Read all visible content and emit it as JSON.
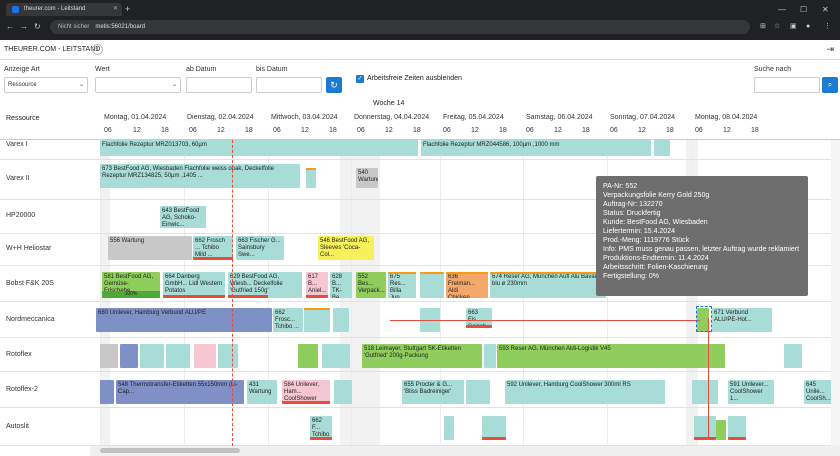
{
  "browser": {
    "tab_title": "theurer.com - Leitstand",
    "insecure": "Nicht sicher",
    "url": "metis:56021/board"
  },
  "app": {
    "title": "THEURER.COM - LEITSTAND"
  },
  "filters": {
    "anzeige_label": "Anzeige Art",
    "anzeige_value": "Ressource",
    "wert_label": "Wert",
    "ab_label": "ab Datum",
    "bis_label": "bis Datum",
    "hide_label": "Arbeitsfreie Zeiten ausblenden",
    "suche_label": "Suche nach"
  },
  "header": {
    "resource_col": "Ressource",
    "week": "Woche 14",
    "days": [
      "Montag, 01.04.2024",
      "Dienstag, 02.04.2024",
      "Mittwoch, 03.04.2024",
      "Donnerstag, 04.04.2024",
      "Freitag, 05.04.2024",
      "Samstag, 06.04.2024",
      "Sonntag, 07.04.2024",
      "Montag, 08.04.2024"
    ],
    "hours": [
      "06",
      "12",
      "18",
      "06",
      "12",
      "18",
      "06",
      "12",
      "18",
      "06",
      "12",
      "18",
      "06",
      "12",
      "18",
      "06",
      "12",
      "18",
      "06",
      "12",
      "18",
      "06",
      "12",
      "18"
    ]
  },
  "resources": [
    "Varex I",
    "Varex II",
    "HP20000",
    "W+H Heliostar",
    "Bobst F&K 20S",
    "Nordmeccanica",
    "Rotoflex",
    "Rotoflex-2",
    "Autoslit"
  ],
  "bars": [
    {
      "t": "Flachfolie Rezeptur MRZ013703, 60µm"
    },
    {
      "t": "Flachfolie Rezeptur MRZ044586, 100µm ,1000 mm"
    },
    {
      "t": "673 BestFood AG, Wiesbaden Flachfolie weiss opak, Deckelfolie Rezeptur MRZ134825, 50µm ,1405 ..."
    },
    {
      "t": "540 Wartung"
    },
    {
      "t": "643 BestFood AG, Schoko-Einwic..."
    },
    {
      "t": "556 Wartung"
    },
    {
      "t": "662 Frosch ... Tchibo Mild ..."
    },
    {
      "t": "663 Fischer G... Sainsbury Swe..."
    },
    {
      "t": "546 BestFood AG, Sleeves 'Coca-Col..."
    },
    {
      "t": "581 BestFood AG, Gemüse-Frischebe..."
    },
    {
      "t": "100%"
    },
    {
      "t": "664 Danberg GmbH... Lidl Western Potatos"
    },
    {
      "t": "629 BestFood AG, Wiesb... Deckelfolie 'Gutfried 150g'"
    },
    {
      "t": "617 B... Aniel..."
    },
    {
      "t": "628 B... TK-Be..."
    },
    {
      "t": "552 Bes... Verpack..."
    },
    {
      "t": "675 Res... Billa Jun..."
    },
    {
      "t": "636 Freiman... Aldi Chicken..."
    },
    {
      "t": "674 Reser AG, München Aufl Alu Bavaria blu ø 230mm"
    },
    {
      "t": "680 Unilever, Hamburg Verbund ALU/PE"
    },
    {
      "t": "662 Frosc... Tchibo ..."
    },
    {
      "t": "663 Fis... Sainsb..."
    },
    {
      "t": "671 Verbund ALU/PE-Hot..."
    },
    {
      "t": "518 Leimayer, Stuttgart SK-Etiketten 'Gutfried' 200g-Packung"
    },
    {
      "t": "593 Reser AG, München Aldi-Logistik V45"
    },
    {
      "t": "548 Thermotransfer-Etiketten 55x150mm (Li-Cap..."
    },
    {
      "t": "431 Wartung"
    },
    {
      "t": "584 Unilever, Ham... CoolShower 20..."
    },
    {
      "t": "655 Procter & G... 'Bliss Badreiniger'"
    },
    {
      "t": "592 Unilever, Hamburg CoolShower 300ml RS"
    },
    {
      "t": "591 Unilever... CoolShower 1..."
    },
    {
      "t": "645 Unile... CoolSh..."
    },
    {
      "t": "662 F... Tchibo"
    }
  ],
  "tooltip": {
    "lines": [
      "PA-Nr: 552",
      "Verpackungsfolie Kerry Gold 250g",
      "Auftrag-Nr: 132270",
      "Status: Druckfertig",
      "Kunde: BestFood AG, Wiesbaden",
      "Liefertermin: 15.4.2024",
      "Prod.-Meng: 1119776 Stück",
      "Info: PMS muss genau passen, letzter Auftrag wurde reklamiert",
      "Produktions-Endtermin: 11.4.2024",
      "Arbeitsschritt: Folien-Kaschierung",
      "Fertigstellung: 0%"
    ]
  }
}
